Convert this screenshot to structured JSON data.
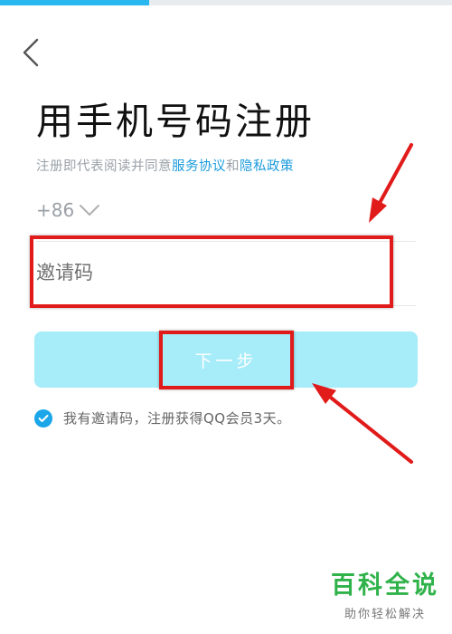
{
  "progress": {
    "fraction": 0.33
  },
  "nav": {
    "back_icon": "chevron-left-icon"
  },
  "title": "用手机号码注册",
  "agreement": {
    "prefix": "注册即代表阅读并同意",
    "service_link": "服务协议",
    "and": "和",
    "privacy_link": "隐私政策"
  },
  "phone": {
    "country_code": "+86",
    "dropdown_icon": "chevron-down-icon"
  },
  "invite_input": {
    "placeholder": "邀请码",
    "value": ""
  },
  "next_button": {
    "label": "下一步"
  },
  "invite_option": {
    "checked": true,
    "text": "我有邀请码，注册获得QQ会员3天。"
  },
  "watermark": {
    "title": "百科全说",
    "subtitle": "助你轻松解决"
  },
  "colors": {
    "accent": "#1a9bdc",
    "button": "#a6ecf9",
    "annotation": "#e11a1a",
    "watermark": "#2fb24a"
  }
}
